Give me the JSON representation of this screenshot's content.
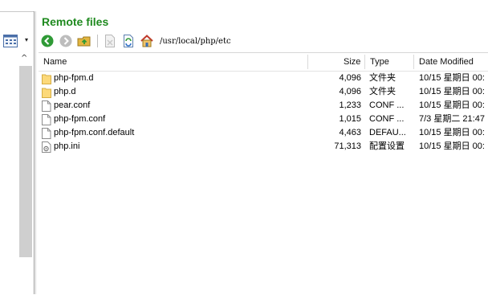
{
  "remote": {
    "title": "Remote files",
    "path": "/usr/local/php/etc",
    "toolbar": {
      "back_icon": "back-arrow-icon",
      "forward_icon": "forward-arrow-icon",
      "parent_icon": "parent-folder-icon",
      "delete_icon": "delete-icon",
      "refresh_icon": "refresh-icon",
      "home_icon": "home-icon"
    },
    "columns": {
      "name": "Name",
      "size": "Size",
      "type": "Type",
      "date": "Date Modified"
    },
    "files": [
      {
        "name": "php-fpm.d",
        "size": "4,096",
        "type": "文件夹",
        "date": "10/15 星期日 00:",
        "icon": "folder-icon"
      },
      {
        "name": "php.d",
        "size": "4,096",
        "type": "文件夹",
        "date": "10/15 星期日 00:",
        "icon": "folder-icon"
      },
      {
        "name": "pear.conf",
        "size": "1,233",
        "type": "CONF ...",
        "date": "10/15 星期日 00:",
        "icon": "file-icon"
      },
      {
        "name": "php-fpm.conf",
        "size": "1,015",
        "type": "CONF ...",
        "date": "7/3 星期二 21:47",
        "icon": "file-icon"
      },
      {
        "name": "php-fpm.conf.default",
        "size": "4,463",
        "type": "DEFAU...",
        "date": "10/15 星期日 00:",
        "icon": "file-icon"
      },
      {
        "name": "php.ini",
        "size": "71,313",
        "type": "配置设置",
        "date": "10/15 星期日 00:",
        "icon": "settings-file-icon"
      }
    ]
  },
  "left_pane": {
    "view_icon": "grid-view-icon",
    "caret": "▾",
    "scroll_up": "^"
  }
}
